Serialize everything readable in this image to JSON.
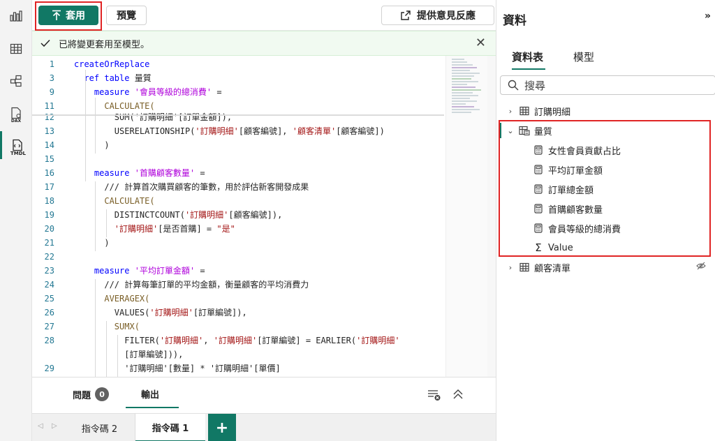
{
  "toolbar": {
    "apply_label": "套用",
    "preview_label": "預覽",
    "feedback_label": "提供意見反應"
  },
  "banner": {
    "message": "已將變更套用至模型。"
  },
  "editor": {
    "line_numbers": [
      "1",
      "3",
      "9",
      "11",
      "12",
      "13",
      "14",
      "15",
      "16",
      "17",
      "18",
      "19",
      "20",
      "21",
      "22",
      "23",
      "24",
      "25",
      "26",
      "27",
      "28",
      "",
      "29"
    ],
    "lines": [
      {
        "n": "1",
        "parts": [
          {
            "t": "createOrReplace",
            "c": "kw"
          }
        ]
      },
      {
        "n": "3",
        "parts": [
          {
            "t": "  ref table ",
            "c": "kw"
          },
          {
            "t": "量質",
            "c": "plain"
          }
        ]
      },
      {
        "n": "9",
        "parts": [
          {
            "t": "    measure ",
            "c": "kw"
          },
          {
            "t": "'會員等級的總消費'",
            "c": "pur"
          },
          {
            "t": " =",
            "c": "plain"
          }
        ]
      },
      {
        "n": "11",
        "parts": [
          {
            "t": "      CALCULATE(",
            "c": "fn"
          }
        ]
      },
      {
        "n": "12",
        "parts": [
          {
            "t": "        SUM('訂購明細'[訂單金額]),",
            "c": "plain"
          }
        ]
      },
      {
        "n": "13",
        "parts": [
          {
            "t": "        USERELATIONSHIP(",
            "c": "plain"
          },
          {
            "t": "'訂購明細'",
            "c": "str"
          },
          {
            "t": "[顧客編號], ",
            "c": "plain"
          },
          {
            "t": "'顧客清單'",
            "c": "str"
          },
          {
            "t": "[顧客編號])",
            "c": "plain"
          }
        ]
      },
      {
        "n": "14",
        "parts": [
          {
            "t": "      )",
            "c": "plain"
          }
        ]
      },
      {
        "n": "15",
        "parts": []
      },
      {
        "n": "16",
        "parts": [
          {
            "t": "    measure ",
            "c": "kw"
          },
          {
            "t": "'首購顧客數量'",
            "c": "pur"
          },
          {
            "t": " =",
            "c": "plain"
          }
        ]
      },
      {
        "n": "17",
        "parts": [
          {
            "t": "      /// 計算首次購買顧客的筆數，用於評估新客開發成果",
            "c": "plain"
          }
        ]
      },
      {
        "n": "18",
        "parts": [
          {
            "t": "      CALCULATE(",
            "c": "fn"
          }
        ]
      },
      {
        "n": "19",
        "parts": [
          {
            "t": "        DISTINCTCOUNT(",
            "c": "plain"
          },
          {
            "t": "'訂購明細'",
            "c": "str"
          },
          {
            "t": "[顧客編號]),",
            "c": "plain"
          }
        ]
      },
      {
        "n": "20",
        "parts": [
          {
            "t": "        ",
            "c": "plain"
          },
          {
            "t": "'訂購明細'",
            "c": "str"
          },
          {
            "t": "[是否首購] = ",
            "c": "plain"
          },
          {
            "t": "\"是\"",
            "c": "str"
          }
        ]
      },
      {
        "n": "21",
        "parts": [
          {
            "t": "      )",
            "c": "plain"
          }
        ]
      },
      {
        "n": "22",
        "parts": []
      },
      {
        "n": "23",
        "parts": [
          {
            "t": "    measure ",
            "c": "kw"
          },
          {
            "t": "'平均訂單金額'",
            "c": "pur"
          },
          {
            "t": " =",
            "c": "plain"
          }
        ]
      },
      {
        "n": "24",
        "parts": [
          {
            "t": "      /// 計算每筆訂單的平均金額，衡量顧客的平均消費力",
            "c": "plain"
          }
        ]
      },
      {
        "n": "25",
        "parts": [
          {
            "t": "      AVERAGEX(",
            "c": "fn"
          }
        ]
      },
      {
        "n": "26",
        "parts": [
          {
            "t": "        VALUES(",
            "c": "plain"
          },
          {
            "t": "'訂購明細'",
            "c": "str"
          },
          {
            "t": "[訂單編號]),",
            "c": "plain"
          }
        ]
      },
      {
        "n": "27",
        "parts": [
          {
            "t": "        SUMX(",
            "c": "fn"
          }
        ]
      },
      {
        "n": "28",
        "parts": [
          {
            "t": "          FILTER(",
            "c": "plain"
          },
          {
            "t": "'訂購明細'",
            "c": "str"
          },
          {
            "t": ", ",
            "c": "plain"
          },
          {
            "t": "'訂購明細'",
            "c": "str"
          },
          {
            "t": "[訂單編號] = EARLIER(",
            "c": "plain"
          },
          {
            "t": "'訂購明細'",
            "c": "str"
          }
        ]
      },
      {
        "n": "",
        "parts": [
          {
            "t": "          [訂單編號])),",
            "c": "plain"
          }
        ]
      },
      {
        "n": "29",
        "parts": [
          {
            "t": "          '訂購明細'[數量] * '訂購明細'[單價]",
            "c": "plain"
          }
        ]
      }
    ]
  },
  "bottom_panel": {
    "problems_label": "問題",
    "problems_count": "0",
    "output_label": "輸出"
  },
  "script_tabs": {
    "tab2_label": "指令碼 2",
    "tab1_label": "指令碼 1",
    "add_label": "+"
  },
  "data_pane": {
    "title": "資料",
    "expand_glyph": "»",
    "tab_tables": "資料表",
    "tab_model": "模型",
    "search_placeholder": "搜尋",
    "tree": [
      {
        "label": "訂購明細",
        "expanded": false,
        "icon": "table-icon"
      },
      {
        "label": "量質",
        "expanded": true,
        "icon": "measure-table-icon"
      },
      {
        "label": "顧客清單",
        "expanded": false,
        "icon": "table-icon",
        "hidden": true
      }
    ],
    "measures": [
      "女性會員貢獻占比",
      "平均訂單金額",
      "訂單總金額",
      "首購顧客數量",
      "會員等級的總消費",
      "Value"
    ]
  },
  "colors": {
    "accent": "#117865",
    "highlight": "#e02424",
    "keyword": "#0000ff",
    "string": "#a31515",
    "measure_name": "#af00db"
  }
}
